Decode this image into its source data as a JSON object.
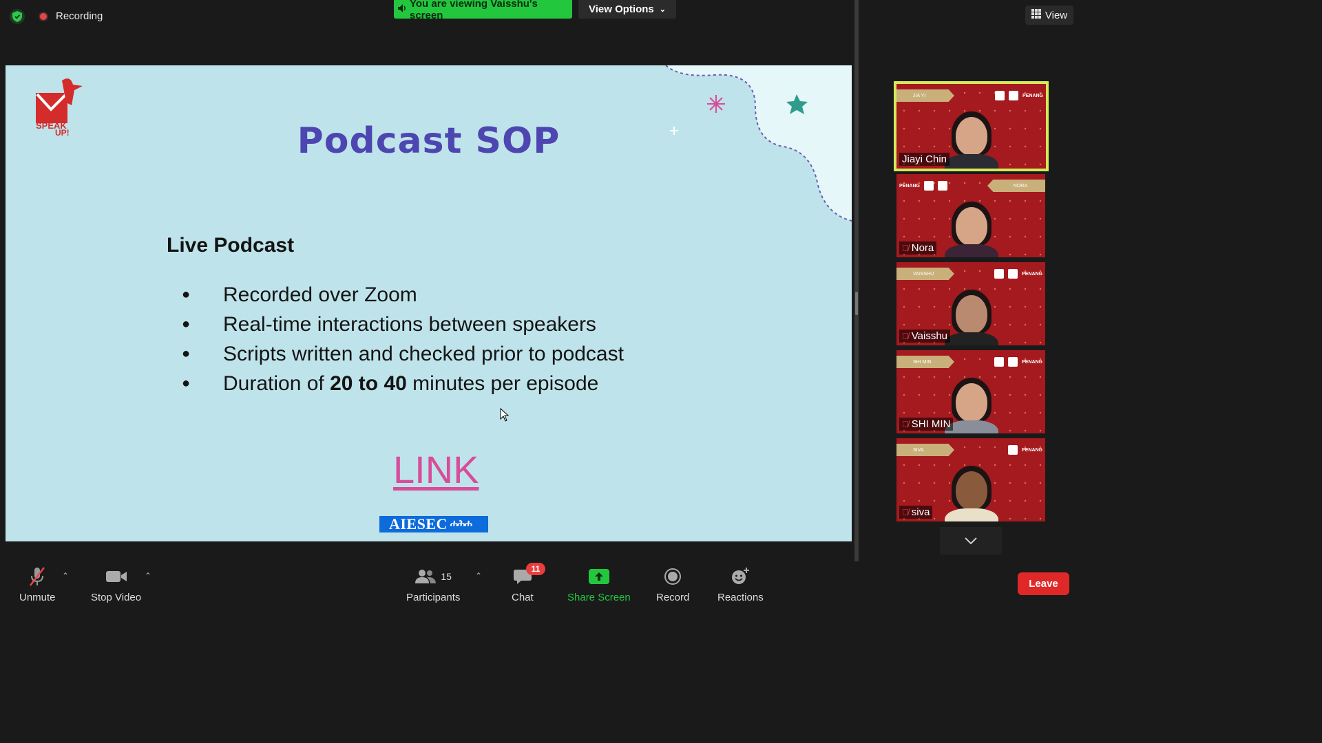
{
  "topbar": {
    "recording_label": "Recording",
    "viewing_banner": "You are viewing Vaisshu's screen",
    "view_options_label": "View Options",
    "view_label": "View"
  },
  "slide": {
    "logo_text": "SPEAK UP!",
    "title": "Podcast SOP",
    "subhead": "Live Podcast",
    "bullets": [
      {
        "pre": "Recorded over Zoom",
        "bold": "",
        "post": ""
      },
      {
        "pre": "Real-time interactions between speakers",
        "bold": "",
        "post": ""
      },
      {
        "pre": "Scripts written and checked prior to podcast",
        "bold": "",
        "post": ""
      },
      {
        "pre": "Duration of ",
        "bold": "20 to 40",
        "post": " minutes per episode"
      }
    ],
    "link_text": "LINK",
    "footer_logo": "AIESEC",
    "colors": {
      "background": "#bfe3ea",
      "title": "#4d46b0",
      "link": "#d84c9a"
    }
  },
  "participants_panel": {
    "tiles": [
      {
        "name": "Jiayi Chin",
        "muted": false,
        "active": true,
        "banner": "JIA YI"
      },
      {
        "name": "Nora",
        "muted": true,
        "active": false,
        "banner": "NORA"
      },
      {
        "name": "Vaisshu",
        "muted": true,
        "active": false,
        "banner": "VAISSHU"
      },
      {
        "name": "SHI MIN",
        "muted": true,
        "active": false,
        "banner": "SHI MIN"
      },
      {
        "name": "siva",
        "muted": true,
        "active": false,
        "banner": "SIVA"
      }
    ],
    "tile_banner_right": "PENANG"
  },
  "toolbar": {
    "unmute_label": "Unmute",
    "stop_video_label": "Stop Video",
    "participants_label": "Participants",
    "participants_count": "15",
    "chat_label": "Chat",
    "chat_badge": "11",
    "share_screen_label": "Share Screen",
    "record_label": "Record",
    "reactions_label": "Reactions",
    "leave_label": "Leave",
    "colors": {
      "share_green": "#23c73e",
      "leave_red": "#e02828"
    }
  }
}
